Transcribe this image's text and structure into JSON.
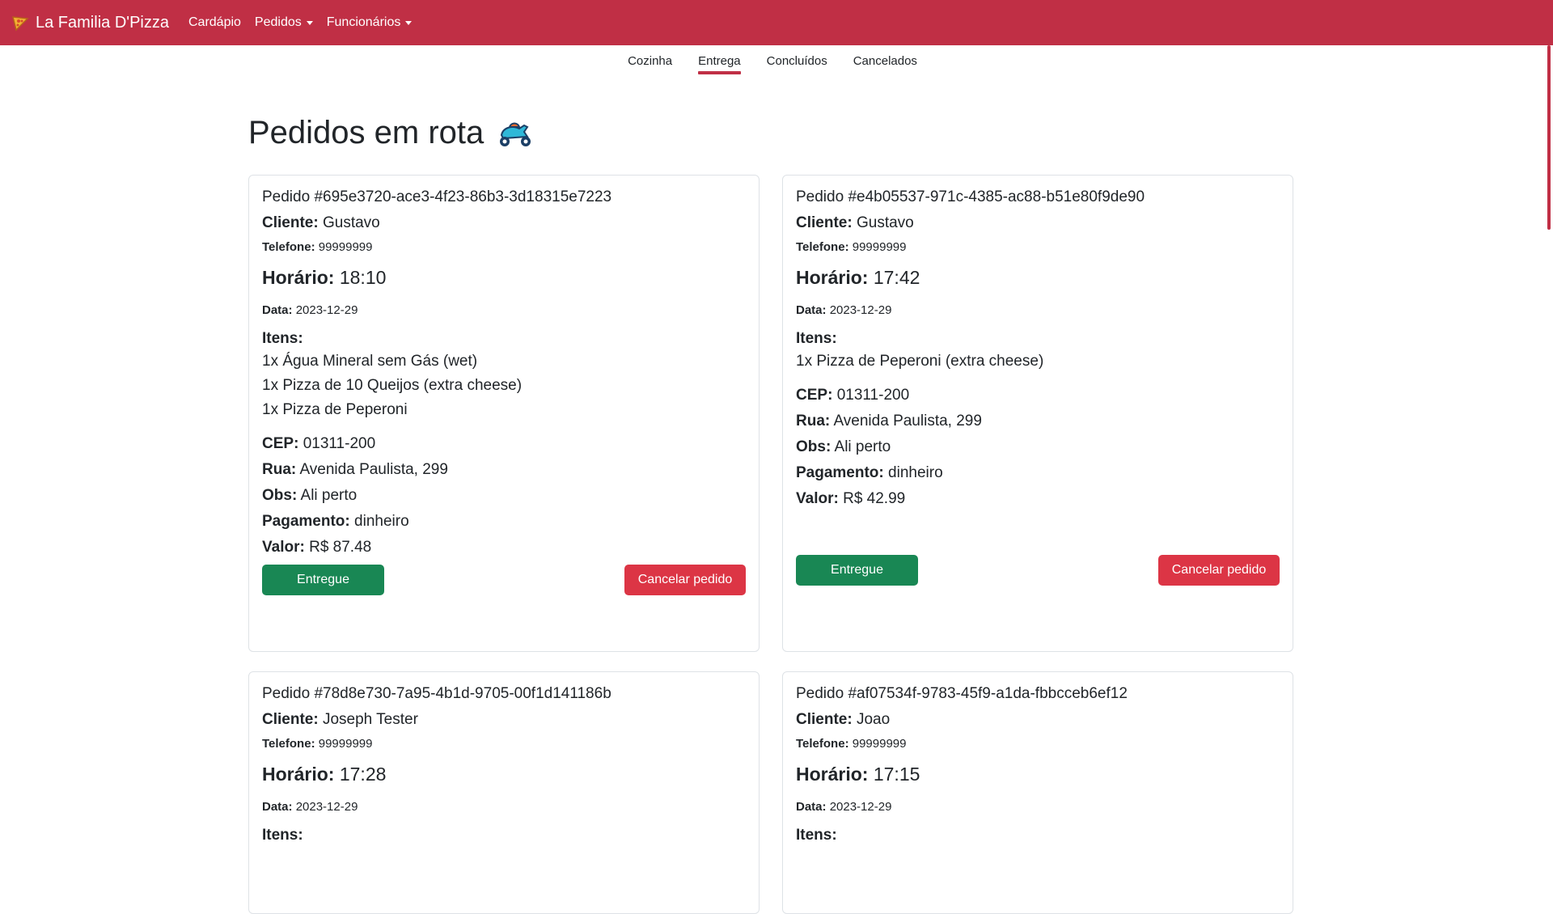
{
  "navbar": {
    "brand": "La Familia D'Pizza",
    "links": [
      {
        "label": "Cardápio"
      },
      {
        "label": "Pedidos"
      },
      {
        "label": "Funcionários"
      }
    ]
  },
  "tabs": [
    {
      "label": "Cozinha"
    },
    {
      "label": "Entrega"
    },
    {
      "label": "Concluídos"
    },
    {
      "label": "Cancelados"
    }
  ],
  "page": {
    "title": "Pedidos em rota"
  },
  "labels": {
    "cliente": "Cliente:",
    "telefone": "Telefone:",
    "horario": "Horário:",
    "data": "Data:",
    "itens": "Itens:",
    "cep": "CEP:",
    "rua": "Rua:",
    "obs": "Obs:",
    "pagamento": "Pagamento:",
    "valor": "Valor:",
    "entregue": "Entregue",
    "cancelar": "Cancelar pedido"
  },
  "orders": [
    {
      "title": "Pedido #695e3720-ace3-4f23-86b3-3d18315e7223",
      "cliente": "Gustavo",
      "telefone": "99999999",
      "horario": "18:10",
      "data": "2023-12-29",
      "items": [
        "1x Água Mineral sem Gás (wet)",
        "1x Pizza de 10 Queijos (extra cheese)",
        "1x Pizza de Peperoni"
      ],
      "cep": "01311-200",
      "rua": "Avenida Paulista, 299",
      "obs": "Ali perto",
      "pagamento": "dinheiro",
      "valor": "R$ 87.48"
    },
    {
      "title": "Pedido #e4b05537-971c-4385-ac88-b51e80f9de90",
      "cliente": "Gustavo",
      "telefone": "99999999",
      "horario": "17:42",
      "data": "2023-12-29",
      "items": [
        "1x Pizza de Peperoni (extra cheese)"
      ],
      "cep": "01311-200",
      "rua": "Avenida Paulista, 299",
      "obs": "Ali perto",
      "pagamento": "dinheiro",
      "valor": "R$ 42.99"
    },
    {
      "title": "Pedido #78d8e730-7a95-4b1d-9705-00f1d141186b",
      "cliente": "Joseph Tester",
      "telefone": "99999999",
      "horario": "17:28",
      "data": "2023-12-29",
      "items": []
    },
    {
      "title": "Pedido #af07534f-9783-45f9-a1da-fbbcceb6ef12",
      "cliente": "Joao",
      "telefone": "99999999",
      "horario": "17:15",
      "data": "2023-12-29",
      "items": []
    }
  ],
  "colors": {
    "brand": "#c02f45",
    "success": "#198754",
    "danger": "#dc3545"
  },
  "icons": {
    "brand": "pizza-icon",
    "heading": "scooter-icon"
  }
}
